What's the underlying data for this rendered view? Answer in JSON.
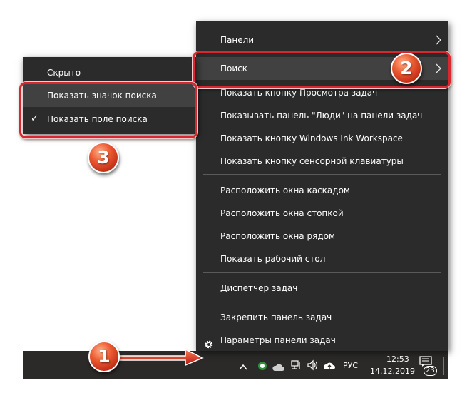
{
  "main_menu": {
    "items": [
      {
        "label": "Панели"
      },
      {
        "label": "Поиск"
      },
      {
        "label": "Показать кнопку Просмотра задач"
      },
      {
        "label": "Показывать панель \"Люди\" на панели задач"
      },
      {
        "label": "Показать кнопку Windows Ink Workspace"
      },
      {
        "label": "Показать кнопку сенсорной клавиатуры"
      },
      {
        "label": "Расположить окна каскадом"
      },
      {
        "label": "Расположить окна стопкой"
      },
      {
        "label": "Расположить окна рядом"
      },
      {
        "label": "Показать рабочий стол"
      },
      {
        "label": "Диспетчер задач"
      },
      {
        "label": "Закрепить панель задач"
      },
      {
        "label": "Параметры панели задач"
      }
    ]
  },
  "sub_menu": {
    "items": [
      {
        "label": "Скрыто"
      },
      {
        "label": "Показать значок поиска"
      },
      {
        "label": "Показать поле поиска",
        "checked": true
      }
    ],
    "check_mark": "✓"
  },
  "taskbar": {
    "language": "РУС",
    "time": "12:53",
    "date": "14.12.2019",
    "notification_count": "23"
  },
  "badges": {
    "one": "1",
    "two": "2",
    "three": "3"
  },
  "colors": {
    "menu_bg": "#2b2b2b",
    "menu_hover": "#414141",
    "taskbar_bg": "#2b2a29",
    "highlight_red": "#d7282f",
    "badge_orange": "#ec5a32"
  },
  "icons": {
    "chevron": "chevron-right-icon",
    "gear": "gear-icon",
    "check": "checkmark-icon"
  }
}
